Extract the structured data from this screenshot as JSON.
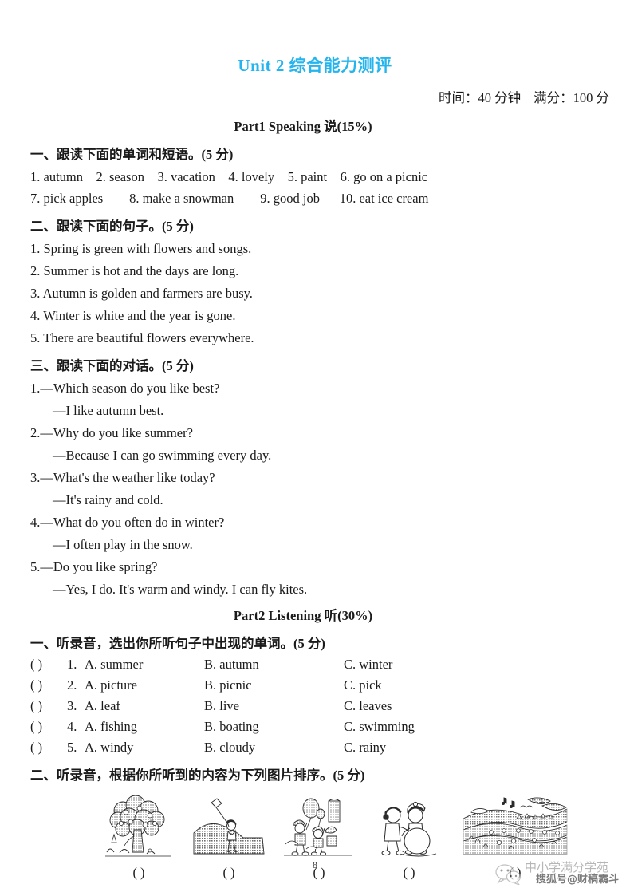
{
  "header": {
    "title_en": "Unit 2 ",
    "title_cn": "综合能力测评",
    "time_label": "时间：40 分钟",
    "total_label": "满分：100 分",
    "part1_heading": "Part1 Speaking 说(15%)",
    "part2_heading": "Part2 Listening 听(30%)"
  },
  "speaking": {
    "s1": {
      "heading": "一、跟读下面的单词和短语。(5 分)",
      "line1": "1. autumn    2. season    3. vacation    4. lovely    5. paint    6. go on a picnic",
      "line2": "7. pick apples        8. make a snowman        9. good job      10. eat ice cream"
    },
    "s2": {
      "heading": "二、跟读下面的句子。(5 分)",
      "items": [
        "1. Spring is green with flowers and songs.",
        "2. Summer is hot and the days are long.",
        "3. Autumn is golden and farmers are busy.",
        "4. Winter is white and the year is gone.",
        "5. There are beautiful flowers everywhere."
      ]
    },
    "s3": {
      "heading": "三、跟读下面的对话。(5 分)",
      "items": [
        {
          "q": "1.—Which season do you like best?",
          "a": "—I like autumn best."
        },
        {
          "q": "2.—Why do you like summer?",
          "a": "—Because I can go swimming every day."
        },
        {
          "q": "3.—What's the weather like today?",
          "a": "—It's rainy and cold."
        },
        {
          "q": "4.—What do you often do in winter?",
          "a": "—I often play in the snow."
        },
        {
          "q": "5.—Do you like spring?",
          "a": "—Yes, I do. It's warm and windy. I can fly kites."
        }
      ]
    }
  },
  "listening": {
    "l1": {
      "heading": "一、听录音，选出你所听句子中出现的单词。(5 分)",
      "bracket": "(      )",
      "rows": [
        {
          "num": "1.",
          "a": "A. summer",
          "b": "B. autumn",
          "c": "C. winter"
        },
        {
          "num": "2.",
          "a": "A. picture",
          "b": "B. picnic",
          "c": "C. pick"
        },
        {
          "num": "3.",
          "a": "A. leaf",
          "b": "B. live",
          "c": "C. leaves"
        },
        {
          "num": "4.",
          "a": "A. fishing",
          "b": "B. boating",
          "c": "C. swimming"
        },
        {
          "num": "5.",
          "a": "A. windy",
          "b": "B. cloudy",
          "c": "C. rainy"
        }
      ]
    },
    "l2": {
      "heading": "二、听录音，根据你所听到的内容为下列图片排序。(5 分)",
      "answer_bracket": "(        )",
      "pictures": [
        {
          "name": "apple-tree-picking"
        },
        {
          "name": "kite-flying-on-hill"
        },
        {
          "name": "children-with-balloons"
        },
        {
          "name": "children-making-snowman"
        },
        {
          "name": "spring-field-landscape"
        }
      ]
    }
  },
  "footer": {
    "page_number": "8",
    "watermark_top": "中小学满分学苑",
    "watermark_bottom": "搜狐号@财稿霸斗"
  }
}
